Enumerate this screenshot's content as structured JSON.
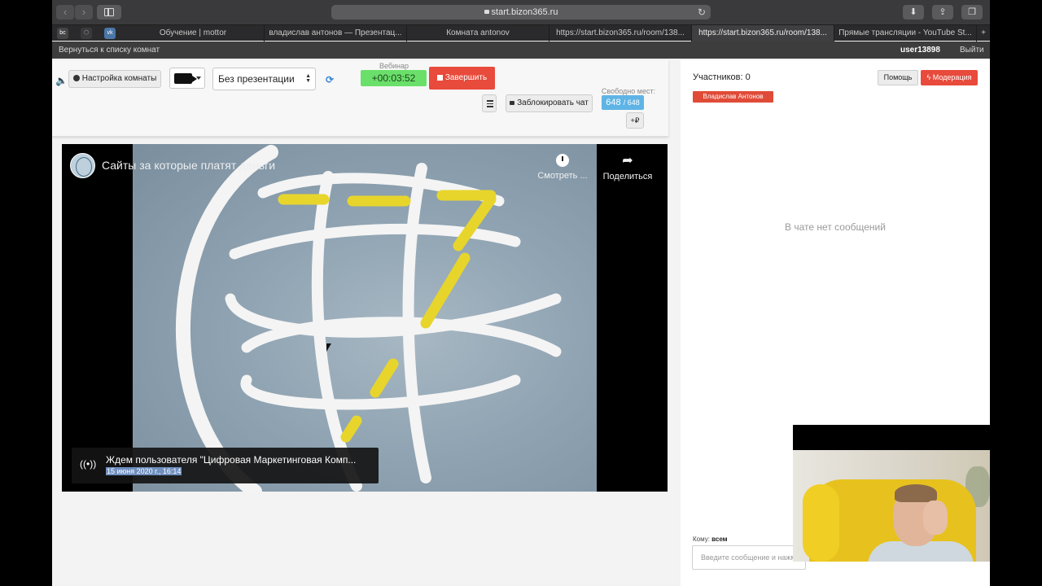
{
  "browser": {
    "url": "start.bizon365.ru",
    "tabs": [
      {
        "label": "Обучение | mottor",
        "active": false
      },
      {
        "label": "владислав антонов — Презентац...",
        "active": false
      },
      {
        "label": "Комната antonov",
        "active": false
      },
      {
        "label": "https://start.bizon365.ru/room/138...",
        "active": false
      },
      {
        "label": "https://start.bizon365.ru/room/138...",
        "active": true
      },
      {
        "label": "Прямые трансляции - YouTube St...",
        "active": false
      }
    ],
    "new_tab": "+"
  },
  "sitebar": {
    "back_link": "Вернуться к списку комнат",
    "username": "user13898",
    "logout": "Выйти"
  },
  "controls": {
    "room_settings": "Настройка комнаты",
    "presentation_select": "Без презентации",
    "webinar_label": "Вебинар",
    "timer": "+00:03:52",
    "finish_button": "Завершить",
    "lock_chat": "Заблокировать чат",
    "free_seats_label": "Свободно мест:",
    "free_seats_count": "648",
    "free_seats_total": "/ 648",
    "plus_button": "+₽"
  },
  "video": {
    "title": "Сайты за которые платят деньги",
    "watch_later": "Смотреть ...",
    "share": "Поделиться",
    "live_status": "Ждем пользователя \"Цифровая Маркетинговая Комп...",
    "live_date": "15 июня 2020 г., 16:14"
  },
  "chat": {
    "participants": "Участников: 0",
    "help_button": "Помощь",
    "moderation_button": "Модерация",
    "user_tag": "Владислав Антонов",
    "empty_message": "В чате нет сообщений",
    "to_label": "Кому:",
    "to_value": "всем",
    "input_placeholder": "Введите сообщение и нажмите Enter"
  },
  "colors": {
    "accent_red": "#e84a3b",
    "timer_green": "#6ae06a",
    "seats_blue": "#5fb4e5"
  }
}
